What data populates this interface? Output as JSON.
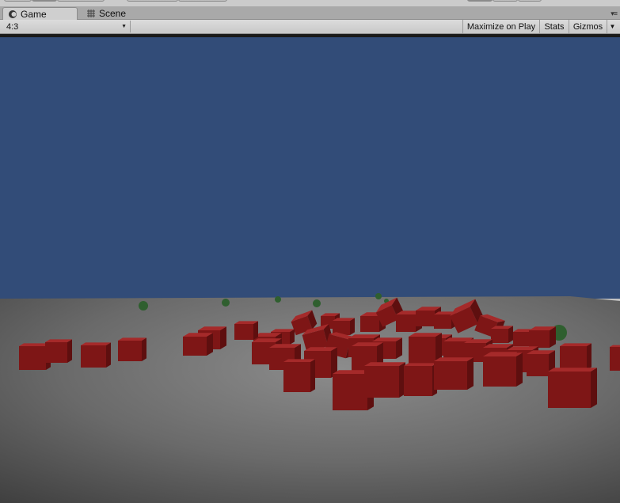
{
  "tabs": [
    {
      "label": "Game",
      "icon": "game-controller-icon",
      "active": true
    },
    {
      "label": "Scene",
      "icon": "grid-icon",
      "active": false
    }
  ],
  "toolbar": {
    "aspect": "4:3",
    "maximize_label": "Maximize on Play",
    "stats_label": "Stats",
    "gizmos_label": "Gizmos"
  },
  "colors": {
    "sky": "#324c78",
    "ground": "#6e6e6e",
    "cube": "#7a1414",
    "sphere": "#2f5f2f"
  }
}
